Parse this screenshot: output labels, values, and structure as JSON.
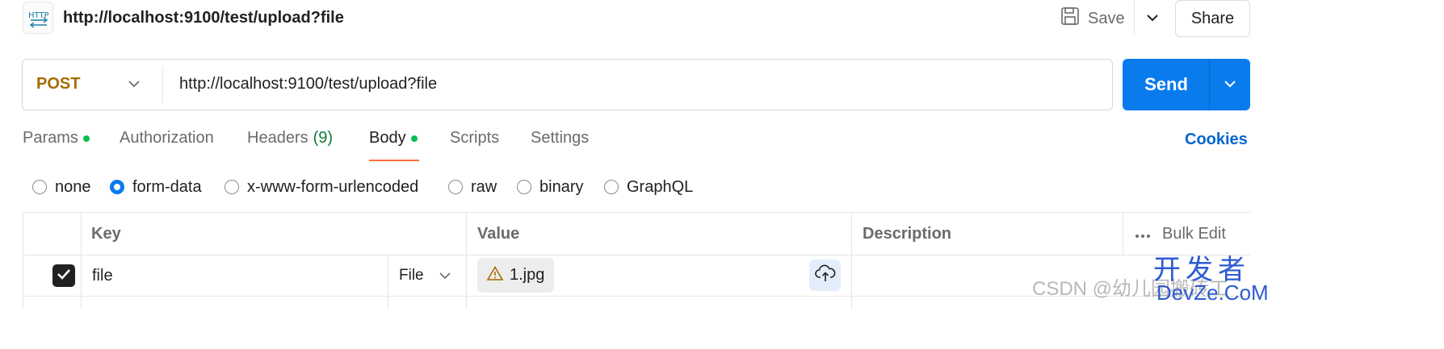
{
  "header": {
    "title": "http://localhost:9100/test/upload?file",
    "save_label": "Save",
    "share_label": "Share"
  },
  "request": {
    "method": "POST",
    "url": "http://localhost:9100/test/upload?file",
    "send_label": "Send"
  },
  "tabs": [
    {
      "label": "Params",
      "dot": true
    },
    {
      "label": "Authorization"
    },
    {
      "label": "Headers",
      "count": "(9)"
    },
    {
      "label": "Body",
      "dot": true,
      "active": true
    },
    {
      "label": "Scripts"
    },
    {
      "label": "Settings"
    }
  ],
  "cookies_label": "Cookies",
  "body_types": [
    {
      "label": "none",
      "selected": false
    },
    {
      "label": "form-data",
      "selected": true
    },
    {
      "label": "x-www-form-urlencoded",
      "selected": false
    },
    {
      "label": "raw",
      "selected": false
    },
    {
      "label": "binary",
      "selected": false
    },
    {
      "label": "GraphQL",
      "selected": false
    }
  ],
  "table": {
    "headers": {
      "key": "Key",
      "value": "Value",
      "description": "Description"
    },
    "bulk_edit_label": "Bulk Edit",
    "rows": [
      {
        "checked": true,
        "key": "file",
        "type": "File",
        "value": "1.jpg",
        "description": ""
      }
    ]
  },
  "watermark": {
    "csdn": "CSDN @幼儿园搬砖工",
    "logo_top": "开发者",
    "logo_bottom": "DevZe.CoM"
  },
  "colors": {
    "accent": "#097bed",
    "method_post": "#a66c00",
    "active_tab_underline": "#ff6c37",
    "status_dot": "#0cbb52",
    "link": "#0265d2"
  },
  "icons": {
    "request": "http-icon",
    "save": "floppy-disk-icon",
    "dropdown": "chevron-down-icon",
    "warning": "warning-triangle-icon",
    "upload": "cloud-upload-icon",
    "more": "more-horizontal-icon",
    "check": "checkmark-icon"
  }
}
